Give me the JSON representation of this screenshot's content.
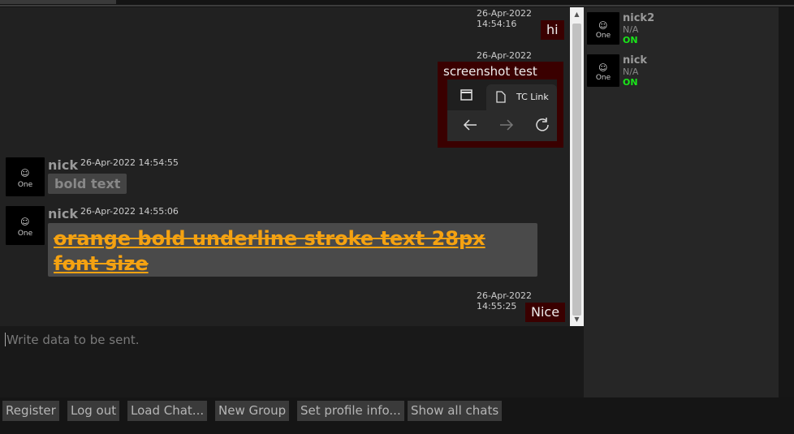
{
  "messages": {
    "out1": {
      "time": "26-Apr-2022 14:54:16",
      "text": "hi"
    },
    "out2": {
      "time": "26-Apr-2022 14:54:29",
      "text": "screenshot test",
      "screenshot": {
        "tab_label": "TC Link"
      }
    },
    "in1": {
      "sender": "nick",
      "time": "26-Apr-2022 14:54:55",
      "text": "bold text",
      "avatar_label": "One"
    },
    "in2": {
      "sender": "nick",
      "time": "26-Apr-2022 14:55:06",
      "text": "orange bold underline stroke text 28px font size",
      "avatar_label": "One",
      "text_color": "#f5a211"
    },
    "out3": {
      "time": "26-Apr-2022 14:55:25",
      "text": "Nice"
    }
  },
  "contacts": [
    {
      "name": "nick2",
      "status": "N/A",
      "presence": "ON",
      "avatar_label": "One"
    },
    {
      "name": "nick",
      "status": "N/A",
      "presence": "ON",
      "avatar_label": "One"
    }
  ],
  "composer": {
    "placeholder": "Write data to be sent."
  },
  "buttons": {
    "register": "Register",
    "logout": "Log out",
    "load_chat": "Load Chat...",
    "new_group": "New Group",
    "set_profile": "Set profile info...",
    "show_all": "Show all chats"
  },
  "colors": {
    "outgoing_bubble": "#3a0000",
    "incoming_bubble": "#444444",
    "online": "#19e619",
    "accent_text": "#f5a211"
  }
}
